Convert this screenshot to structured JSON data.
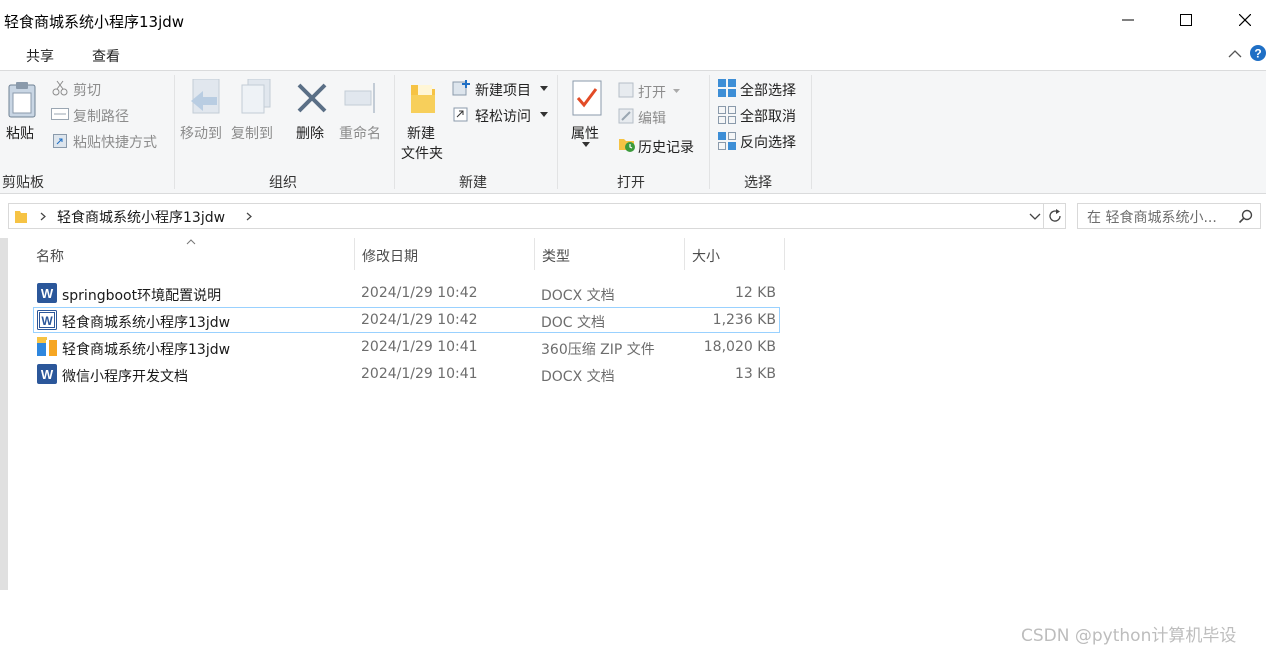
{
  "window": {
    "title": "轻食商城系统小程序13jdw"
  },
  "ribbon_tabs": [
    {
      "label": "共享"
    },
    {
      "label": "查看"
    }
  ],
  "clipboard": {
    "paste": "粘贴",
    "cut": "剪切",
    "copy_path": "复制路径",
    "paste_shortcut": "粘贴快捷方式",
    "group": "剪贴板"
  },
  "organize": {
    "move_to": "移动到",
    "copy_to": "复制到",
    "delete": "删除",
    "rename": "重命名",
    "group": "组织"
  },
  "new": {
    "new_folder_line1": "新建",
    "new_folder_line2": "文件夹",
    "new_item": "新建项目",
    "easy_access": "轻松访问",
    "group": "新建"
  },
  "open": {
    "properties": "属性",
    "open": "打开",
    "edit": "编辑",
    "history": "历史记录",
    "group": "打开"
  },
  "select": {
    "select_all": "全部选择",
    "select_none": "全部取消",
    "invert": "反向选择",
    "group": "选择"
  },
  "address": {
    "path": "轻食商城系统小程序13jdw"
  },
  "search": {
    "placeholder": "在 轻食商城系统小..."
  },
  "columns": {
    "name": "名称",
    "date": "修改日期",
    "type": "类型",
    "size": "大小"
  },
  "files": [
    {
      "name": "springboot环境配置说明",
      "date": "2024/1/29 10:42",
      "type": "DOCX 文档",
      "size": "12 KB",
      "icon": "word-icon"
    },
    {
      "name": "轻食商城系统小程序13jdw",
      "date": "2024/1/29 10:42",
      "type": "DOC 文档",
      "size": "1,236 KB",
      "icon": "word-doc-icon"
    },
    {
      "name": "轻食商城系统小程序13jdw",
      "date": "2024/1/29 10:41",
      "type": "360压缩 ZIP 文件",
      "size": "18,020 KB",
      "icon": "zip-icon"
    },
    {
      "name": "微信小程序开发文档",
      "date": "2024/1/29 10:41",
      "type": "DOCX 文档",
      "size": "13 KB",
      "icon": "word-icon"
    }
  ],
  "watermark": "CSDN @python计算机毕设",
  "colors": {
    "accent": "#0067c0",
    "selection": "#99d1ff",
    "folder": "#f6c344",
    "word": "#2b579a"
  }
}
